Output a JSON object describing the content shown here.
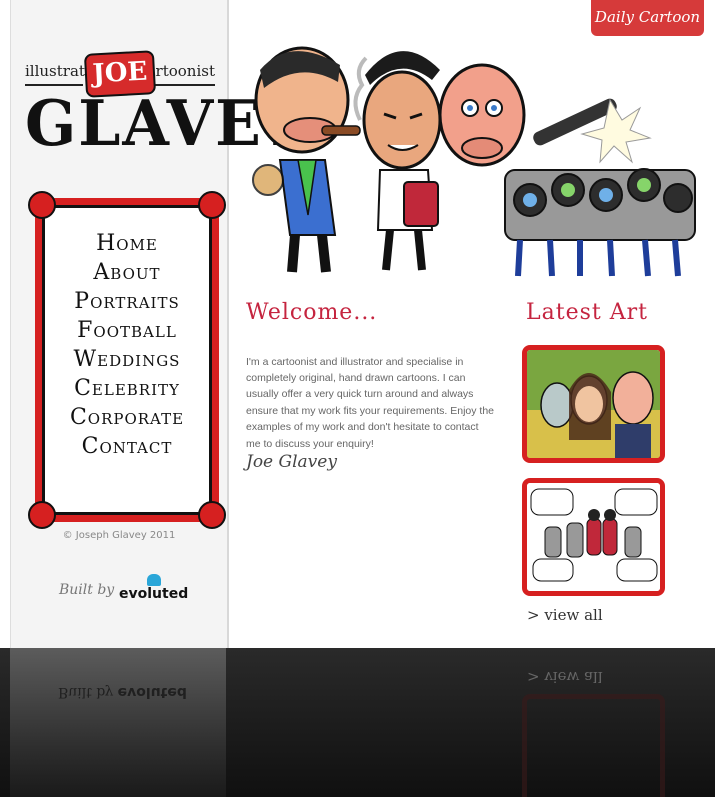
{
  "header": {
    "daily_cartoon_label": "Daily Cartoon ›"
  },
  "sidebar": {
    "logo": {
      "tag_left": "illustrator",
      "tag_right": "cartoonist",
      "first_name": "JOE",
      "last_name": "GLAVEY"
    },
    "nav": [
      {
        "label": "Home"
      },
      {
        "label": "About"
      },
      {
        "label": "Portraits"
      },
      {
        "label": "Football"
      },
      {
        "label": "Weddings"
      },
      {
        "label": "Celebrity"
      },
      {
        "label": "Corporate"
      },
      {
        "label": "Contact"
      }
    ],
    "copyright": "© Joseph Glavey 2011",
    "built_by": "Built by",
    "built_by_company": "evoluted"
  },
  "main": {
    "welcome_heading": "Welcome...",
    "intro": "I'm a cartoonist and illustrator and specialise in completely original, hand drawn cartoons. I can usually offer a very quick turn around and always ensure that my work fits your requirements. Enjoy the examples of my work and don't hesitate to contact me to discuss your enquiry!",
    "signature": "Joe Glavey"
  },
  "latest": {
    "heading": "Latest Art",
    "view_all": "> view all"
  },
  "colors": {
    "accent_red": "#d62020",
    "heading_pink": "#c5243f",
    "button_red": "#d63a3a"
  }
}
